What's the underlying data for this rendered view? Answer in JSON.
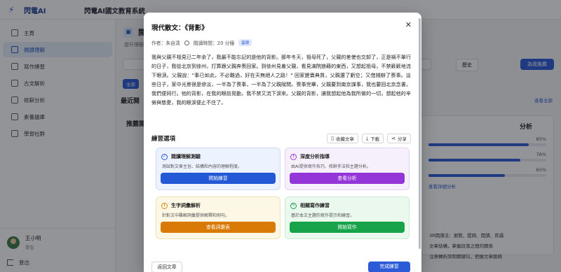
{
  "app": {
    "logo_text": "閃電AI",
    "title": "閃電AI國文教育系統"
  },
  "sidebar": {
    "items": [
      {
        "label": "主頁",
        "icon": "home-icon"
      },
      {
        "label": "閱讀理解",
        "icon": "book-icon",
        "active": true
      },
      {
        "label": "寫作練習",
        "icon": "pencil-icon"
      },
      {
        "label": "古文解析",
        "icon": "scroll-icon"
      },
      {
        "label": "修辭分析",
        "icon": "chart-icon"
      },
      {
        "label": "素養題庫",
        "icon": "database-icon"
      },
      {
        "label": "學習社群",
        "icon": "people-icon"
      }
    ],
    "user": {
      "name": "王小明",
      "role": "學生"
    },
    "logout_label": "登出"
  },
  "background": {
    "page_title": "閱",
    "page_subtitle": "提升理解文",
    "chip_all": "全部",
    "history_button": "歷史",
    "recommend_button": "為我推薦",
    "recent_title": "最近閱",
    "see_all": "查看全部",
    "recommended_title": "推薦閱",
    "analysis_title": "分析",
    "analysis_bars": [
      {
        "pct": "85%",
        "value": 0.85
      },
      {
        "pct": "78%",
        "value": 0.78
      },
      {
        "pct": "65%",
        "value": 0.65
      }
    ],
    "analysis_link": "查看詳細分析",
    "bullets": [
      "3R閱讀法：瀏覽、提問、閱讀、背誦",
      "文章結構，掌握段落之間的關係",
      "注意轉折詞和關鍵句，把握文章脈絡"
    ]
  },
  "modal": {
    "title": "現代散文：《背影》",
    "author": "作者：朱自清",
    "reading_time": "閱讀時間：20 分鐘",
    "level_badge": "基礎",
    "body": "我與父親不相見已二年余了，我最不能忘記的是他的背影。那年冬天，祖母死了，父親的差使也交卸了，正是禍不單行的日子，我從北京到徐州，打算跟父親奔喪回家。到徐州見着父親，看見滿院狼藉的東西，又想起祖母，不禁簌簌地流下眼淚。父親說：\"事已如此，不必難過，好在天無絕人之路！\" 回家變賣典質，父親還了虧空；又借錢辦了喪事。這些日子，家中光景很是慘淡，一半為了喪事，一半為了父親賦閒。喪事完畢，父親要到南京謀事，我也要回北京念書，我們便同行。他的背影，在我的眼前晃動，我不禁又流下淚來。父親的背影，讓我想起他為我所做的一切，想起他的辛勞與慈愛，我的眼淚便止不住了。",
    "body_visible": "我與父親不相見已二年余了，我最不能忘記的是他的背影。那年冬天，祖母死了，父親的差使也交卸了，正是禍不單行的日子，我從北京到徐州，打算跟父親奔喪回家。到徐州見着父親，看見滿院狼藉的東西，又想起祖母，不禁簌簌地流下眼淚。父親說：\"事已如此，不必難過，好在天無絕人之路！\" 回家變賣典質，父親還了虧空；又借錢辦了喪事。這些日子，家中光景很是慘淡，一半為了喪事，一半為了父親賦閒。喪事完畢，父親要到南京謀事，我也要回北京念書，我們便同行。他的背影，在我的眼前晃動，我不禁又流下淚來。父親的背影，讓我想起他為我所做的一切，想起他的辛勞與慈愛，我的眼淚便止不住了。",
    "section_label": "練習選項",
    "actions": {
      "favorite": "收藏文章",
      "download": "下載",
      "share": "分享"
    },
    "practice_cards": [
      {
        "title": "閱讀理解測驗",
        "desc": "測試對文章主旨、結構和內容的理解程度。",
        "button": "開始練習",
        "icon": "check-circle-icon",
        "color": "blue"
      },
      {
        "title": "深度分析指導",
        "desc": "由AI提供寫作技巧、修辭手法和主題分析。",
        "button": "查看分析",
        "icon": "lightbulb-icon",
        "color": "purple"
      },
      {
        "title": "生字詞彙解析",
        "desc": "針對文中難解詞彙提供解釋和例句。",
        "button": "查看詞彙表",
        "icon": "info-circle-icon",
        "color": "yellow"
      },
      {
        "title": "相關寫作練習",
        "desc": "基於本文主題的寫作提示和練習。",
        "button": "開始寫作",
        "icon": "edit-icon",
        "color": "green"
      }
    ],
    "back_button": "返回文章",
    "done_button": "完成練習"
  },
  "colors": {
    "primary": "#2d5bd7",
    "purple": "#9435d8",
    "orange": "#d97a06",
    "green": "#16a34a"
  }
}
